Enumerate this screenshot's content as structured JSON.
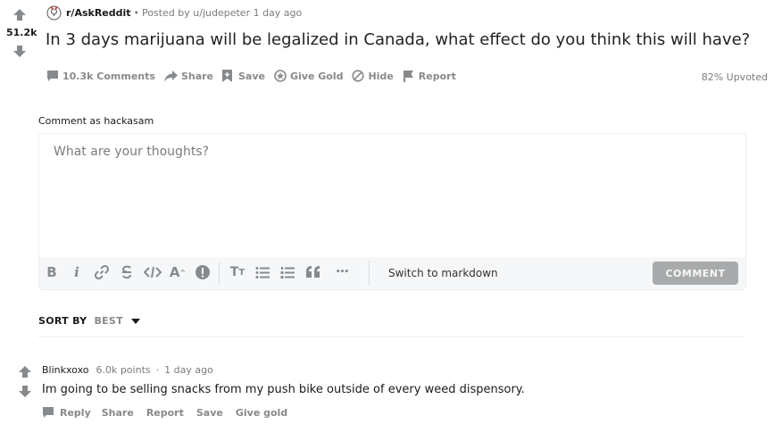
{
  "post": {
    "score": "51.2k",
    "subreddit": "r/AskReddit",
    "separator": "•",
    "posted_by": "Posted by u/judepeter 1 day ago",
    "title": "In 3 days marijuana will be legalized in Canada, what effect do you think this will have?",
    "actions": {
      "comments": "10.3k Comments",
      "share": "Share",
      "save": "Save",
      "give_gold": "Give Gold",
      "hide": "Hide",
      "report": "Report"
    },
    "upvoted": "82% Upvoted"
  },
  "composer": {
    "label": "Comment as hackasam",
    "placeholder": "What are your thoughts?",
    "toolbar": {
      "bold": "B",
      "italic": "i",
      "superscript": "A",
      "heading": "T",
      "more": "•••"
    },
    "switch_markdown": "Switch to markdown",
    "submit": "COMMENT"
  },
  "sort": {
    "label": "SORT BY",
    "value": "BEST"
  },
  "comment": {
    "author": "Blinkxoxo",
    "points": "6.0k points",
    "dot": "·",
    "time": "1 day ago",
    "body": "Im going to be selling snacks from my push bike outside of every weed dispensory.",
    "actions": {
      "reply": "Reply",
      "share": "Share",
      "report": "Report",
      "save": "Save",
      "give_gold": "Give gold"
    }
  },
  "colors": {
    "text_primary": "#1a1a1b",
    "text_muted": "#878a8c",
    "border": "#edeff1",
    "button_disabled": "#a8aaab"
  }
}
